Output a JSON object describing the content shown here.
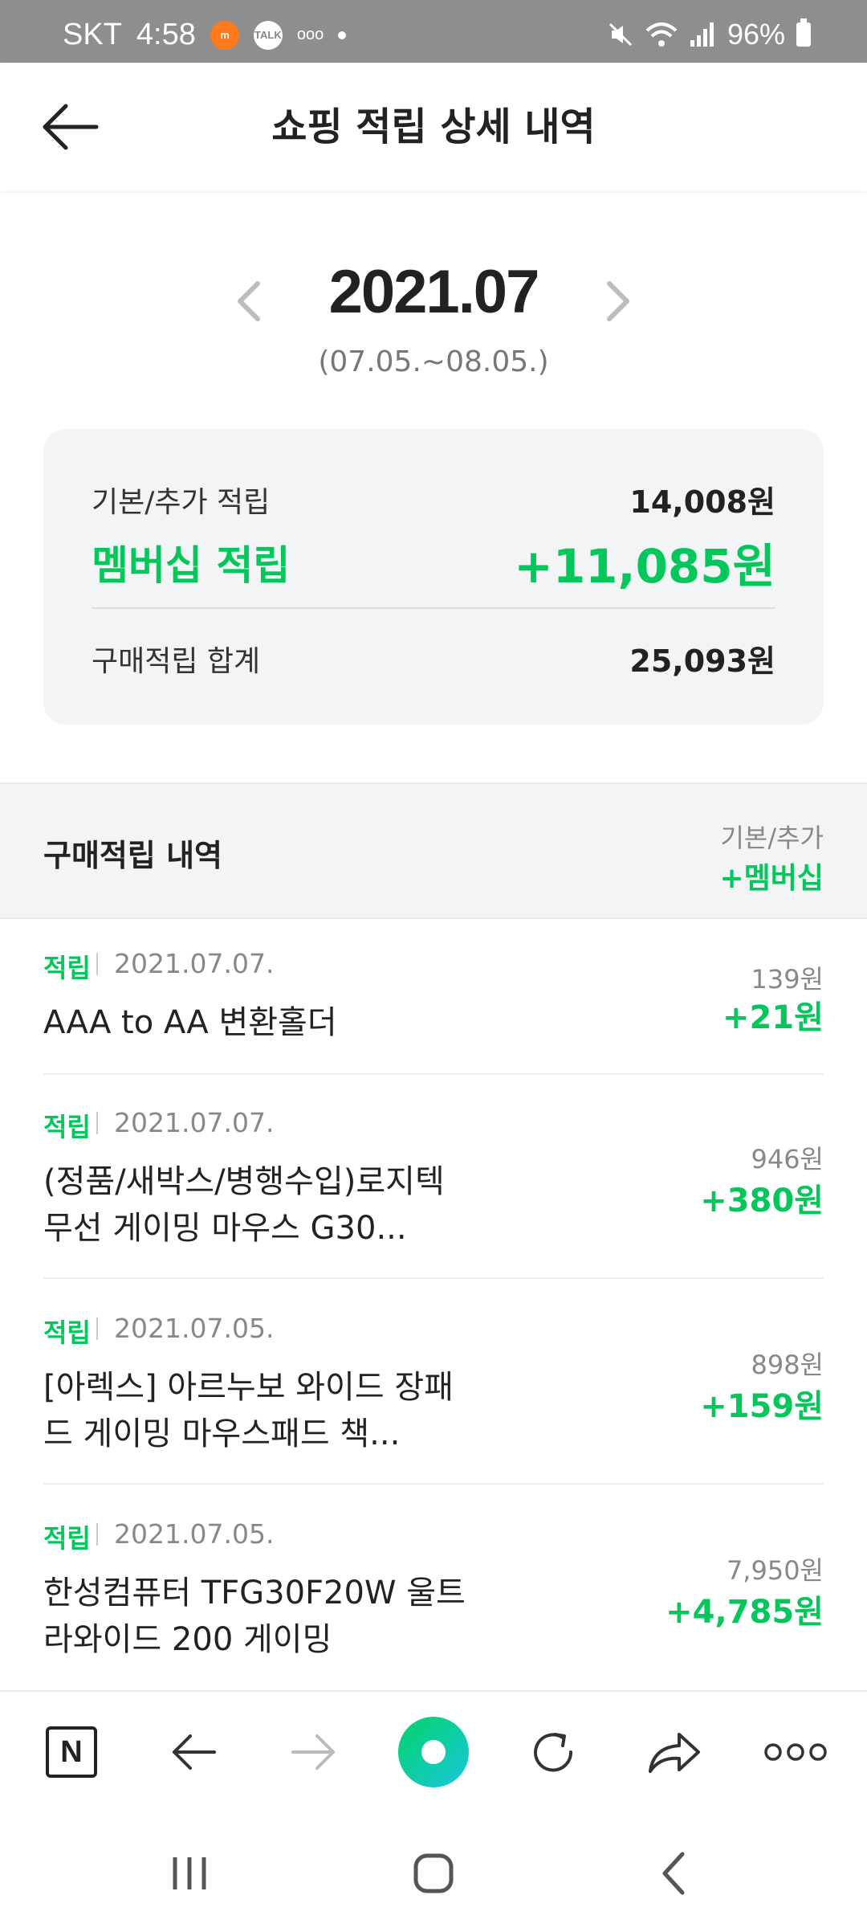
{
  "status_bar": {
    "carrier": "SKT",
    "time": "4:58",
    "battery": "96%",
    "icons": [
      "app-icon-orange",
      "talk-icon",
      "ooo-icon",
      "dot-icon",
      "mute-icon",
      "wifi-icon",
      "signal-icon",
      "battery-icon"
    ]
  },
  "header": {
    "title": "쇼핑 적립 상세 내역",
    "back_icon": "arrow-left-icon"
  },
  "month_selector": {
    "month": "2021.07",
    "range": "(07.05.~08.05.)"
  },
  "summary": {
    "basic_label": "기본/추가 적립",
    "basic_amount": "14,008원",
    "membership_label": "멤버십 적립",
    "membership_amount": "+11,085원",
    "total_label": "구매적립 합계",
    "total_amount": "25,093원"
  },
  "list_header": {
    "title": "구매적립 내역",
    "right_line1": "기본/추가",
    "right_line2": "+멤버십"
  },
  "items": [
    {
      "tag": "적립",
      "date": "2021.07.07.",
      "name": "AAA to AA 변환홀더",
      "base": "139원",
      "membership": "+21원"
    },
    {
      "tag": "적립",
      "date": "2021.07.07.",
      "name": "(정품/새박스/병행수입)로지텍 무선 게이밍 마우스 G30...",
      "base": "946원",
      "membership": "+380원"
    },
    {
      "tag": "적립",
      "date": "2021.07.05.",
      "name": "[아렉스] 아르누보 와이드 장패드 게이밍 마우스패드 책...",
      "base": "898원",
      "membership": "+159원"
    },
    {
      "tag": "적립",
      "date": "2021.07.05.",
      "name": "한성컴퓨터 TFG30F20W 울트라와이드 200 게이밍",
      "base": "7,950원",
      "membership": "+4,785원"
    }
  ],
  "toolbar": {
    "n_label": "N",
    "icons": [
      "naver-home-icon",
      "back-arrow-icon",
      "forward-arrow-icon",
      "green-dot-icon",
      "refresh-icon",
      "share-icon",
      "more-icon"
    ]
  },
  "nav_bar": {
    "icons": [
      "recent-apps-icon",
      "home-icon",
      "back-icon"
    ]
  },
  "colors": {
    "accent_green": "#03c75a",
    "status_bar": "#8e8e8e",
    "card_bg": "#f3f4f6"
  }
}
